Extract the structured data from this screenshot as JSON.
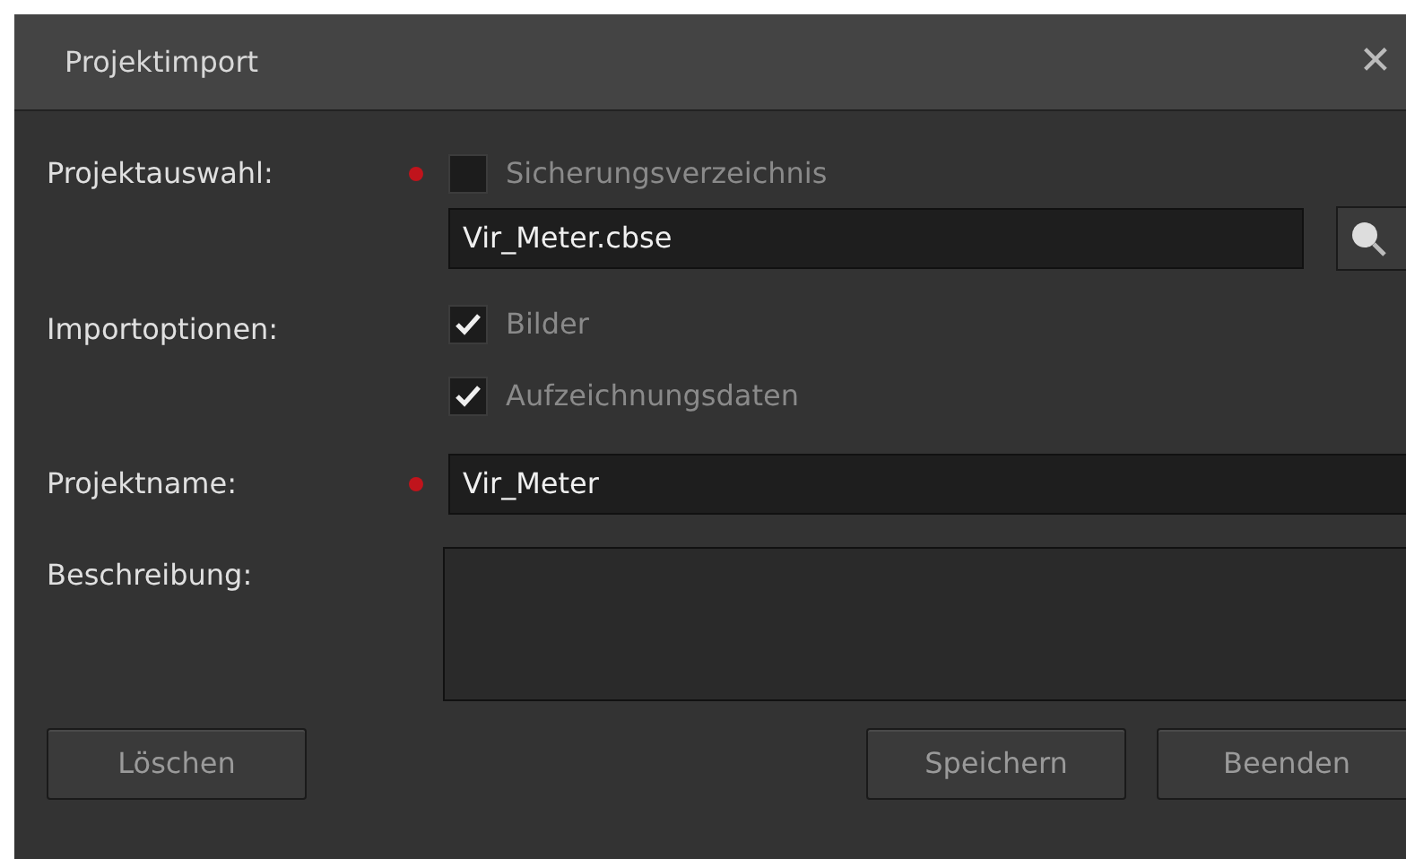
{
  "window": {
    "title": "Projektimport",
    "close": "✕"
  },
  "project_selection": {
    "label": "Projektauswahl:",
    "required": true,
    "checkbox": {
      "label": "Sicherungsverzeichnis",
      "checked": false
    },
    "file": {
      "value": "Vir_Meter.cbse"
    }
  },
  "import_options": {
    "label": "Importoptionen:",
    "options": [
      {
        "label": "Bilder",
        "checked": true
      },
      {
        "label": "Aufzeichnungsdaten",
        "checked": true
      }
    ]
  },
  "project_name": {
    "label": "Projektname:",
    "required": true,
    "value": "Vir_Meter"
  },
  "description": {
    "label": "Beschreibung:"
  },
  "buttons": {
    "left": [
      "Löschen"
    ],
    "right": [
      "Speichern",
      "Beenden"
    ]
  }
}
